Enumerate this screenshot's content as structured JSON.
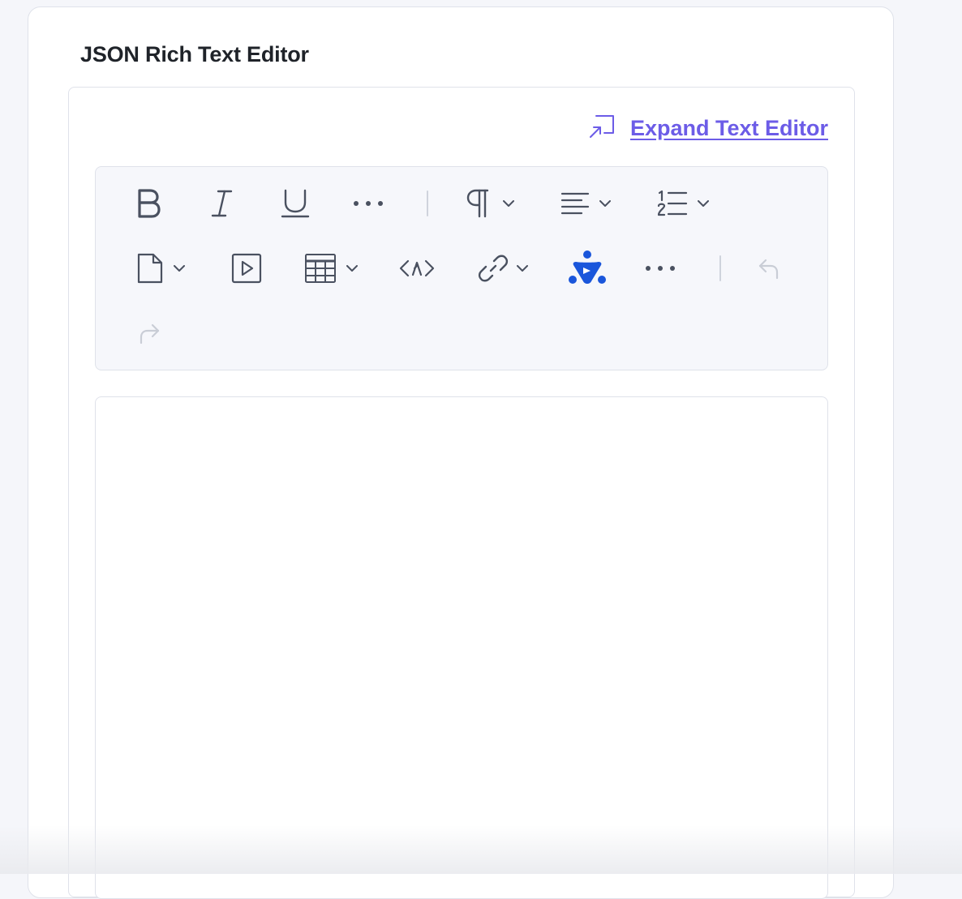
{
  "field": {
    "title": "JSON Rich Text Editor"
  },
  "expand": {
    "label": "Expand Text Editor",
    "icon": "expand-icon"
  },
  "toolbar": {
    "row1": [
      {
        "name": "bold-button",
        "icon": "bold-icon"
      },
      {
        "name": "italic-button",
        "icon": "italic-icon"
      },
      {
        "name": "underline-button",
        "icon": "underline-icon"
      },
      {
        "name": "more-formatting-button",
        "icon": "more-horizontal-icon"
      },
      {
        "name": "paragraph-dropdown",
        "icon": "pilcrow-icon"
      },
      {
        "name": "align-dropdown",
        "icon": "align-left-icon"
      },
      {
        "name": "ordered-list-dropdown",
        "icon": "ordered-list-icon"
      }
    ],
    "row2": [
      {
        "name": "asset-dropdown",
        "icon": "document-icon"
      },
      {
        "name": "embed-video-button",
        "icon": "video-play-icon"
      },
      {
        "name": "table-dropdown",
        "icon": "table-icon"
      },
      {
        "name": "embed-code-button",
        "icon": "code-embed-icon"
      },
      {
        "name": "link-dropdown",
        "icon": "link-icon"
      },
      {
        "name": "brand-plugin-button",
        "icon": "brand-logo-icon"
      },
      {
        "name": "more-options-button",
        "icon": "more-horizontal-icon"
      },
      {
        "name": "undo-button",
        "icon": "undo-icon"
      }
    ],
    "row3": [
      {
        "name": "redo-button",
        "icon": "redo-icon"
      }
    ]
  },
  "colors": {
    "accent": "#6c5ce7",
    "icon": "#4a5160",
    "brand_blue": "#1a56db",
    "disabled": "#c9cdd6"
  }
}
